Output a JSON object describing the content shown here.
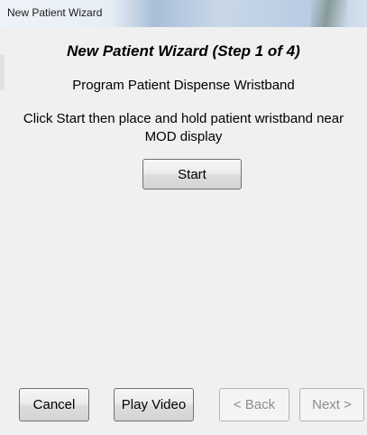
{
  "window": {
    "title": "New Patient Wizard"
  },
  "wizard": {
    "heading": "New Patient Wizard (Step 1 of 4)",
    "subheading": "Program Patient Dispense Wristband",
    "instructions": "Click Start then place and hold patient wristband near MOD display",
    "start_label": "Start"
  },
  "footer": {
    "cancel_label": "Cancel",
    "play_video_label": "Play Video",
    "back_label": "< Back",
    "next_label": "Next >",
    "back_enabled": false,
    "next_enabled": false
  }
}
